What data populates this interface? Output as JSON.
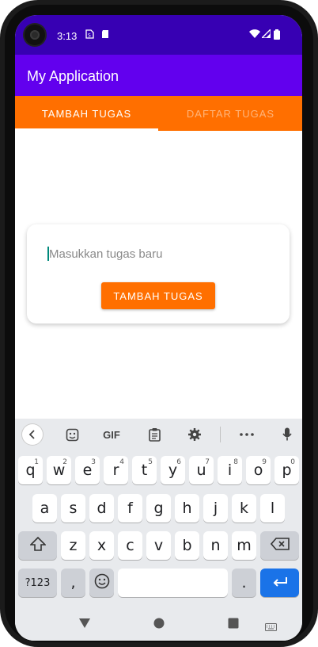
{
  "status_bar": {
    "time": "3:13",
    "icons": [
      "camera-icon",
      "sim-icon",
      "sd-card-icon",
      "wifi-icon",
      "signal-icon",
      "battery-icon"
    ]
  },
  "app_bar": {
    "title": "My Application",
    "color": "#6200ee"
  },
  "tabs": [
    {
      "label": "TAMBAH TUGAS",
      "selected": true
    },
    {
      "label": "DAFTAR TUGAS",
      "selected": false
    }
  ],
  "tab_bar_color": "#ff6f00",
  "form": {
    "input_value": "",
    "input_placeholder": "Masukkan tugas baru",
    "button_label": "TAMBAH TUGAS"
  },
  "keyboard": {
    "toolbar": {
      "gif_label": "GIF",
      "icons": [
        "back-icon",
        "sticker-icon",
        "gif-icon",
        "clipboard-icon",
        "settings-icon",
        "more-icon",
        "mic-icon"
      ]
    },
    "row1": [
      {
        "key": "q",
        "hint": "1"
      },
      {
        "key": "w",
        "hint": "2"
      },
      {
        "key": "e",
        "hint": "3"
      },
      {
        "key": "r",
        "hint": "4"
      },
      {
        "key": "t",
        "hint": "5"
      },
      {
        "key": "y",
        "hint": "6"
      },
      {
        "key": "u",
        "hint": "7"
      },
      {
        "key": "i",
        "hint": "8"
      },
      {
        "key": "o",
        "hint": "9"
      },
      {
        "key": "p",
        "hint": "0"
      }
    ],
    "row2": [
      "a",
      "s",
      "d",
      "f",
      "g",
      "h",
      "j",
      "k",
      "l"
    ],
    "row3": [
      "z",
      "x",
      "c",
      "v",
      "b",
      "n",
      "m"
    ],
    "symbols_label": "?123",
    "comma_label": ",",
    "period_label": "."
  },
  "nav_bar": {
    "icons": [
      "back-nav-icon",
      "home-nav-icon",
      "recents-nav-icon",
      "keyboard-switch-icon"
    ]
  }
}
